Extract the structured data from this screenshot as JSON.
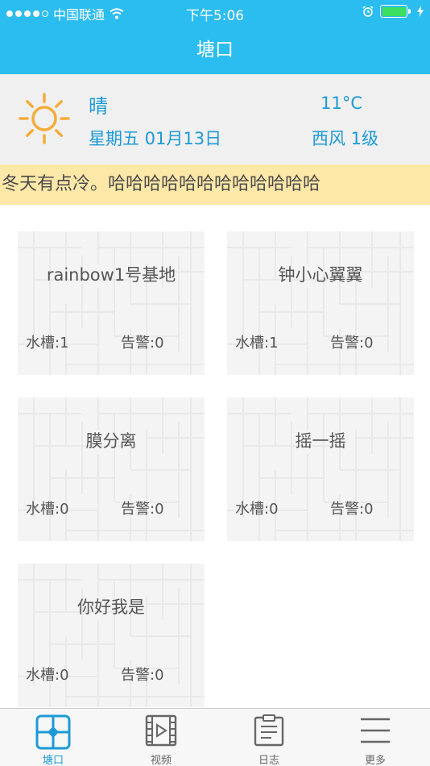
{
  "status_bar": {
    "carrier": "中国联通",
    "time": "下午5:06",
    "battery_color": "#3be062"
  },
  "nav": {
    "title": "塘口"
  },
  "weather": {
    "icon": "sun-icon",
    "condition": "晴",
    "date": "星期五  01月13日",
    "temperature": "11°C",
    "wind": "西风 1级"
  },
  "notice": {
    "text": "冬天有点冷。哈哈哈哈哈哈哈哈哈哈哈哈"
  },
  "ponds": [
    {
      "name": "rainbow1号基地",
      "tank": "水槽:1",
      "alarm": "告警:0"
    },
    {
      "name": "钟小心翼翼",
      "tank": "水槽:1",
      "alarm": "告警:0"
    },
    {
      "name": "膜分离",
      "tank": "水槽:0",
      "alarm": "告警:0"
    },
    {
      "name": "摇一摇",
      "tank": "水槽:0",
      "alarm": "告警:0"
    },
    {
      "name": "你好我是",
      "tank": "水槽:0",
      "alarm": "告警:0"
    }
  ],
  "tabs": [
    {
      "label": "塘口",
      "icon": "grid-icon",
      "active": true
    },
    {
      "label": "视频",
      "icon": "video-icon",
      "active": false
    },
    {
      "label": "日志",
      "icon": "clipboard-icon",
      "active": false
    },
    {
      "label": "更多",
      "icon": "menu-icon",
      "active": false
    }
  ],
  "colors": {
    "accent": "#2cbdf0",
    "text_blue": "#1c9ad6",
    "notice_bg": "#fde8a8",
    "sun": "#f5ac3a"
  }
}
